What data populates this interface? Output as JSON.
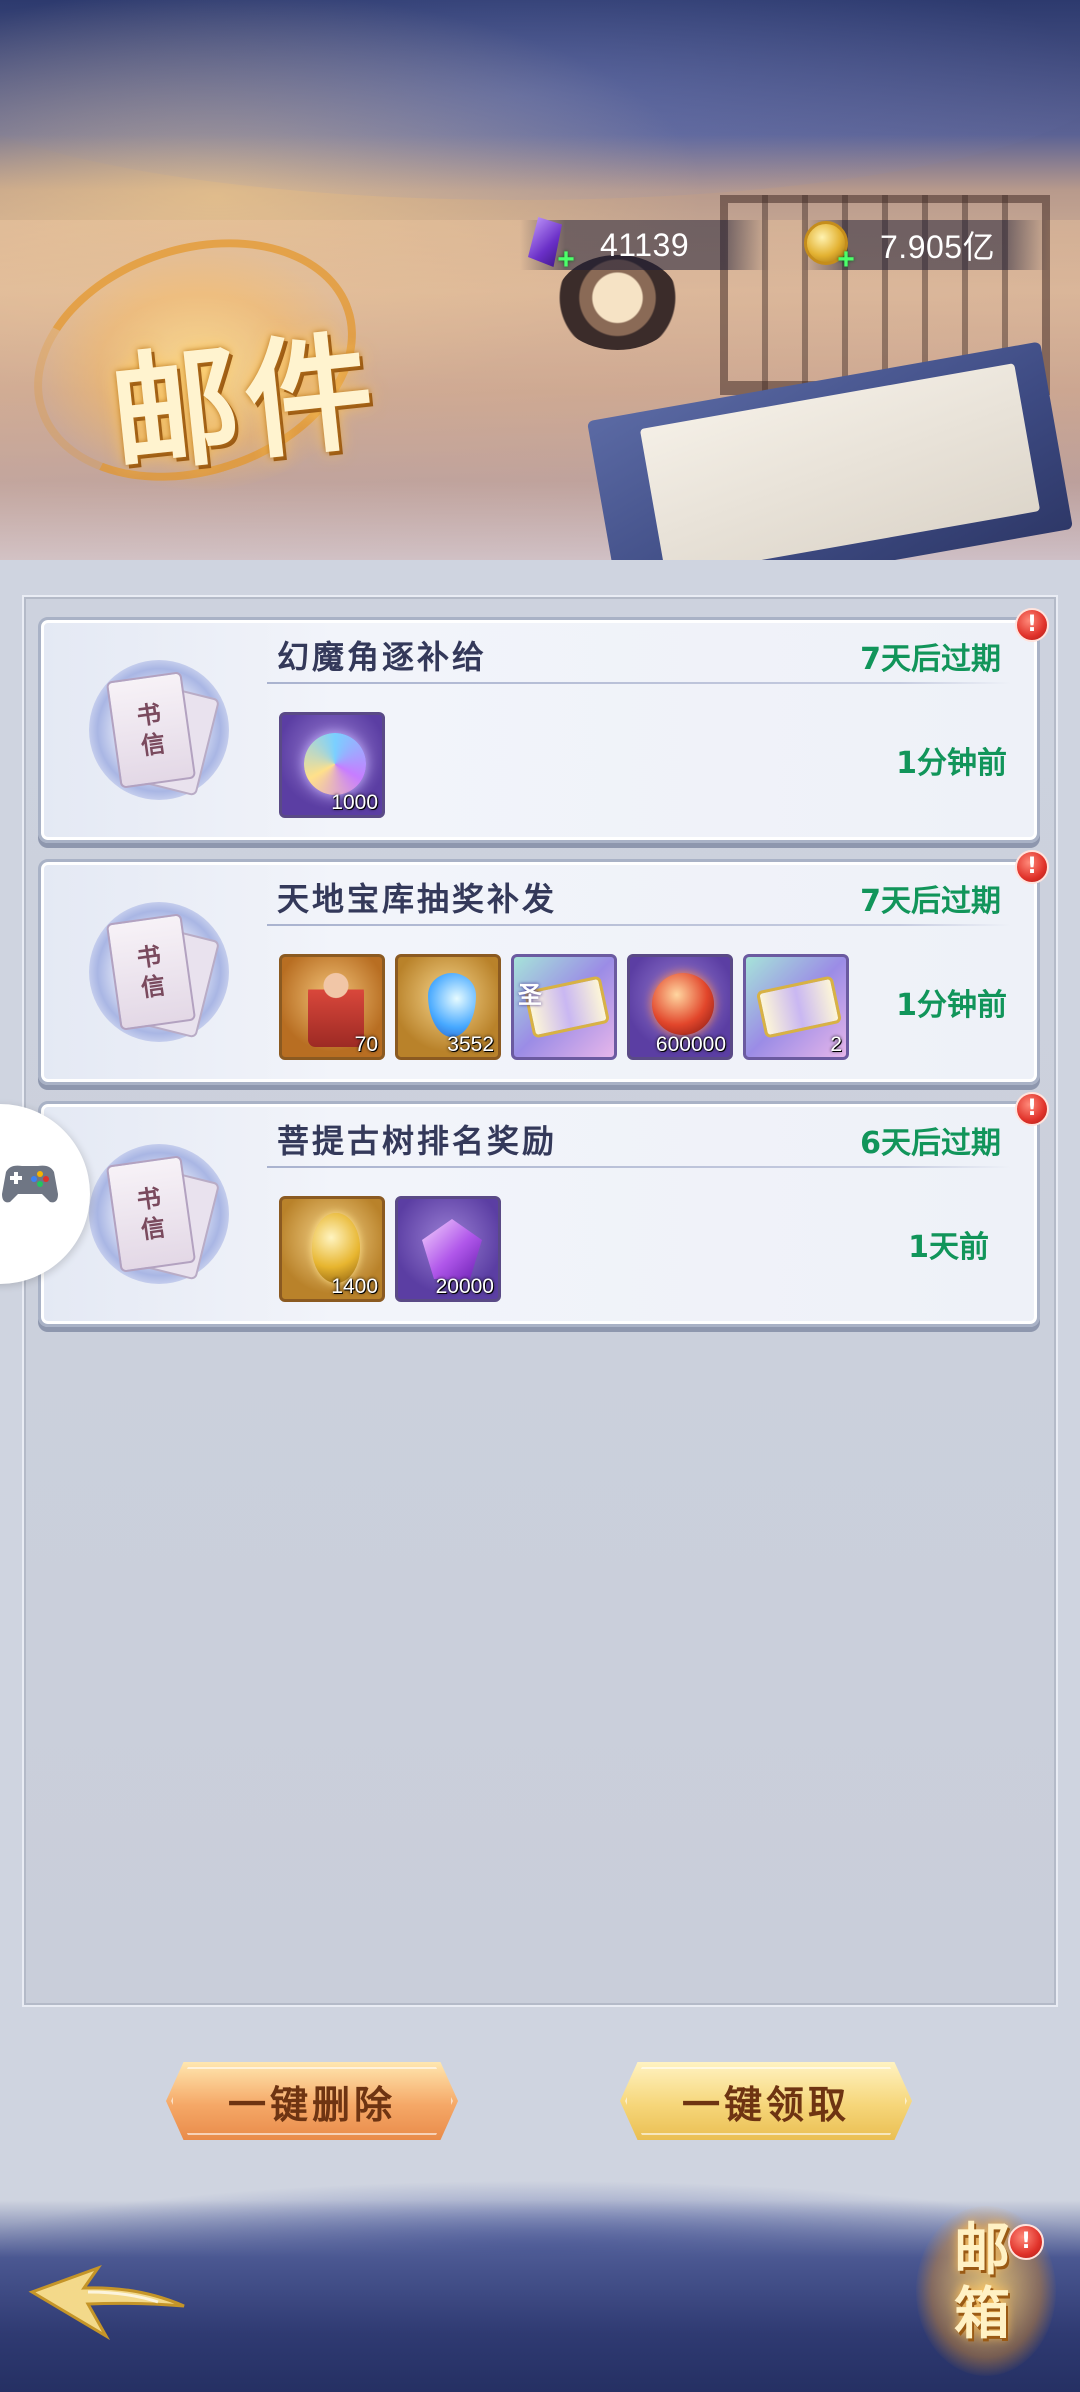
{
  "header": {
    "title": "邮件",
    "currencies": [
      {
        "icon": "purple-gem-icon",
        "value": "41139"
      },
      {
        "icon": "gold-coin-icon",
        "value": "7.905亿"
      }
    ]
  },
  "mails": [
    {
      "title": "幻魔角逐补给",
      "expire": "7天后过期",
      "time": "1分钟前",
      "icon_label": [
        "书",
        "信"
      ],
      "items": [
        {
          "icon": "spirit-swirl-icon",
          "qty": "1000"
        }
      ]
    },
    {
      "title": "天地宝库抽奖补发",
      "expire": "7天后过期",
      "time": "1分钟前",
      "icon_label": [
        "书",
        "信"
      ],
      "items": [
        {
          "icon": "character-figure-icon",
          "qty": "70"
        },
        {
          "icon": "blue-drop-icon",
          "qty": "3552"
        },
        {
          "icon": "scroll-icon",
          "qty": "",
          "sticker": "圣"
        },
        {
          "icon": "fire-orb-icon",
          "qty": "600000"
        },
        {
          "icon": "scroll-icon",
          "qty": "2"
        }
      ]
    },
    {
      "title": "菩提古树排名奖励",
      "expire": "6天后过期",
      "time": "1天前",
      "icon_label": [
        "书",
        "信"
      ],
      "items": [
        {
          "icon": "golden-seed-icon",
          "qty": "1400"
        },
        {
          "icon": "purple-crystal-icon",
          "qty": "20000"
        }
      ]
    }
  ],
  "buttons": {
    "delete_all": "一键删除",
    "claim_all": "一键领取"
  },
  "footer": {
    "mailbox_label": "邮箱",
    "alert_mark": "!"
  },
  "colors": {
    "expire_green": "#11955a",
    "title_text": "#34395a",
    "alert_red": "#e0322a"
  }
}
